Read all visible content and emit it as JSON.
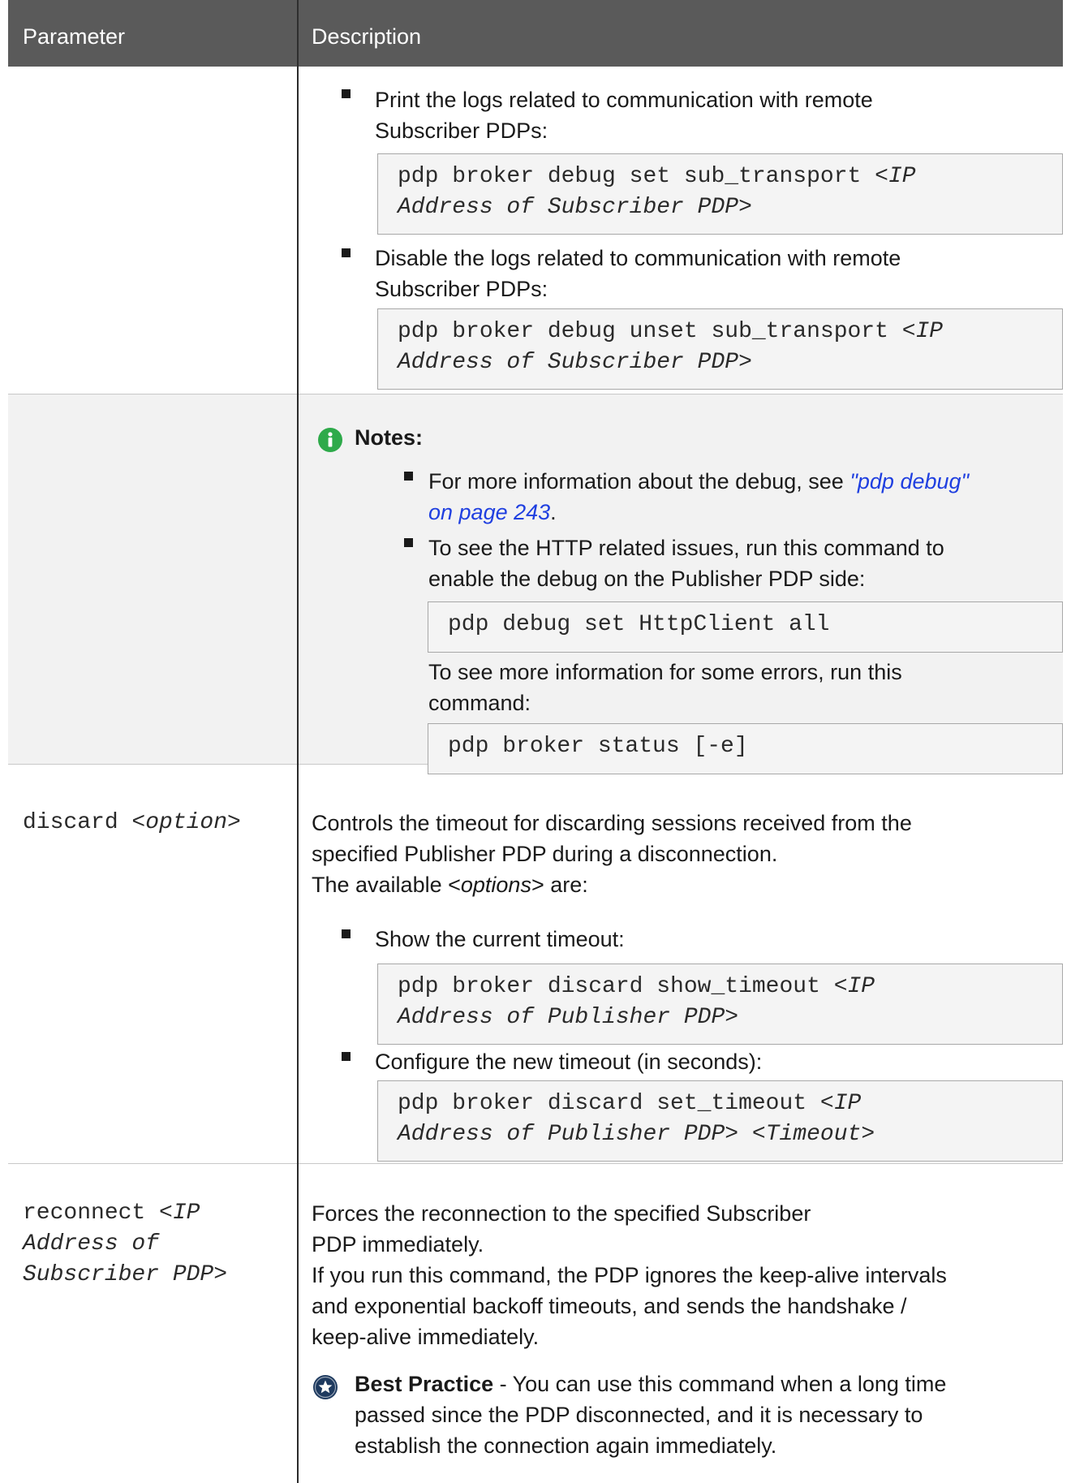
{
  "table": {
    "header": {
      "parameter": "Parameter",
      "description": "Description"
    }
  },
  "row1": {
    "bullet1": {
      "line1": "Print the logs related to communication with remote",
      "line2": "Subscriber PDPs:"
    },
    "code1": {
      "cmd": "pdp broker debug set sub_transport ",
      "arg_a": "<IP",
      "arg_b": "Address of Subscriber PDP",
      "arg_c": ">"
    },
    "bullet2": {
      "line1": "Disable the logs related to communication with remote",
      "line2": "Subscriber PDPs:"
    },
    "code2": {
      "cmd": "pdp broker debug unset sub_transport ",
      "arg_a": "<IP",
      "arg_b": "Address of Subscriber PDP",
      "arg_c": ">"
    }
  },
  "notes": {
    "title": "Notes:",
    "icon": "info-icon",
    "item1": {
      "pre": "For more information about the debug, see ",
      "link1": "\"pdp debug\"",
      "link2": "on page 243",
      "post": "."
    },
    "item2": {
      "line1": "To see the HTTP related issues, run this command to",
      "line2": "enable the debug on the Publisher PDP side:"
    },
    "code1": "pdp debug set HttpClient all",
    "para": {
      "line1": "To see more information for some errors, run this",
      "line2": "command:"
    },
    "code2": "pdp broker status [-e]"
  },
  "discard": {
    "param_cmd": "discard ",
    "param_arg": "<option>",
    "desc_line1": "Controls the timeout for discarding sessions received from the",
    "desc_line2": "specified Publisher PDP during a disconnection.",
    "desc_line3_pre": "The available <",
    "desc_line3_it": "options",
    "desc_line3_post": "> are:",
    "bullet1": "Show the current timeout:",
    "code1": {
      "cmd": "pdp broker discard show_timeout ",
      "arg_a": "<IP",
      "arg_b": "Address of Publisher PDP",
      "arg_c": ">"
    },
    "bullet2": "Configure the new timeout (in seconds):",
    "code2": {
      "cmd": "pdp broker discard set_timeout ",
      "arg_a": "<IP",
      "arg_b": "Address of Publisher PDP",
      "arg_c": "> <",
      "arg_d": "Timeout",
      "arg_e": ">"
    }
  },
  "reconnect": {
    "param_cmd": "reconnect ",
    "param_arg_a": "<IP",
    "param_arg_b": "Address of",
    "param_arg_c": "Subscriber PDP",
    "param_arg_d": ">",
    "desc_line1": "Forces the reconnection to the specified Subscriber",
    "desc_line2": "PDP immediately.",
    "desc_line3": "If you run this command, the PDP ignores the keep-alive intervals",
    "desc_line4": "and exponential backoff timeouts, and sends the handshake /",
    "desc_line5": "keep-alive immediately.",
    "bp_icon": "star-icon",
    "bp_title": "Best Practice",
    "bp_line1": " - You can use this command when a long time",
    "bp_line2": "passed since the PDP disconnected, and it is necessary to",
    "bp_line3": "establish the connection again immediately."
  },
  "colors": {
    "header_bg": "#5a5a5a",
    "note_icon": "#2eaa4a",
    "bp_icon": "#1e3a5f",
    "link": "#1f3fe0",
    "gray_row": "#f2f2f2"
  }
}
